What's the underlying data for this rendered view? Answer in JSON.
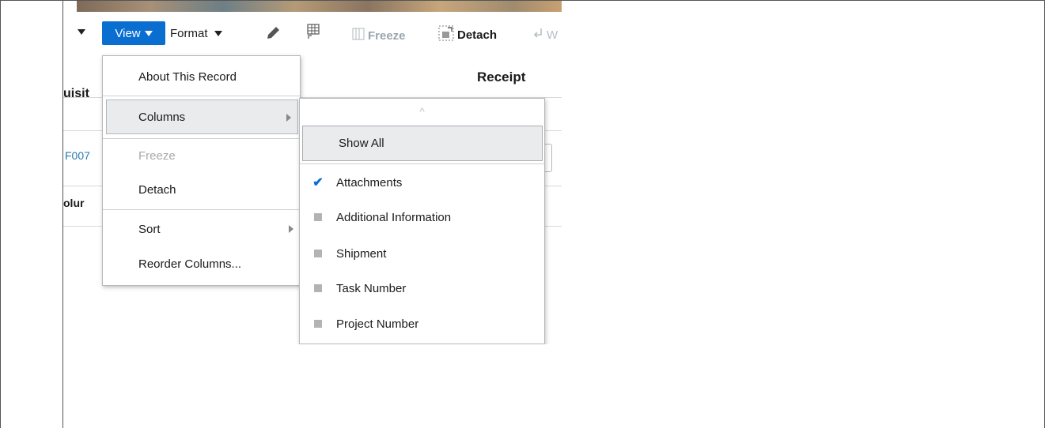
{
  "toolbar": {
    "view_label": "View",
    "format_label": "Format",
    "freeze_label": "Freeze",
    "detach_label": "Detach",
    "wrap_partial": "W",
    "icons": [
      "caret-down-icon",
      "pencil-icon",
      "table-export-icon",
      "freeze-icon",
      "detach-icon",
      "wrap-icon"
    ]
  },
  "table": {
    "partial_header_left": "uisit",
    "header_receipt": "Receipt",
    "partial_link": "F007",
    "partial_row": "olur"
  },
  "view_menu": {
    "items": [
      {
        "label": "About This Record",
        "disabled": false,
        "submenu": false
      },
      {
        "label": "Columns",
        "disabled": false,
        "submenu": true,
        "highlighted": true
      },
      {
        "label": "Freeze",
        "disabled": true,
        "submenu": false
      },
      {
        "label": "Detach",
        "disabled": false,
        "submenu": false
      },
      {
        "label": "Sort",
        "disabled": false,
        "submenu": true
      },
      {
        "label": "Reorder Columns...",
        "disabled": false,
        "submenu": false
      }
    ]
  },
  "columns_submenu": {
    "show_all_label": "Show All",
    "items": [
      {
        "label": "Attachments",
        "checked": true
      },
      {
        "label": "Additional Information",
        "checked": false
      },
      {
        "label": "Shipment",
        "checked": false
      },
      {
        "label": "Task Number",
        "checked": false
      },
      {
        "label": "Project Number",
        "checked": false
      }
    ]
  },
  "colors": {
    "accent": "#0a6ed1",
    "highlight_bg": "#e9ebed",
    "link": "#2a7ab0"
  }
}
